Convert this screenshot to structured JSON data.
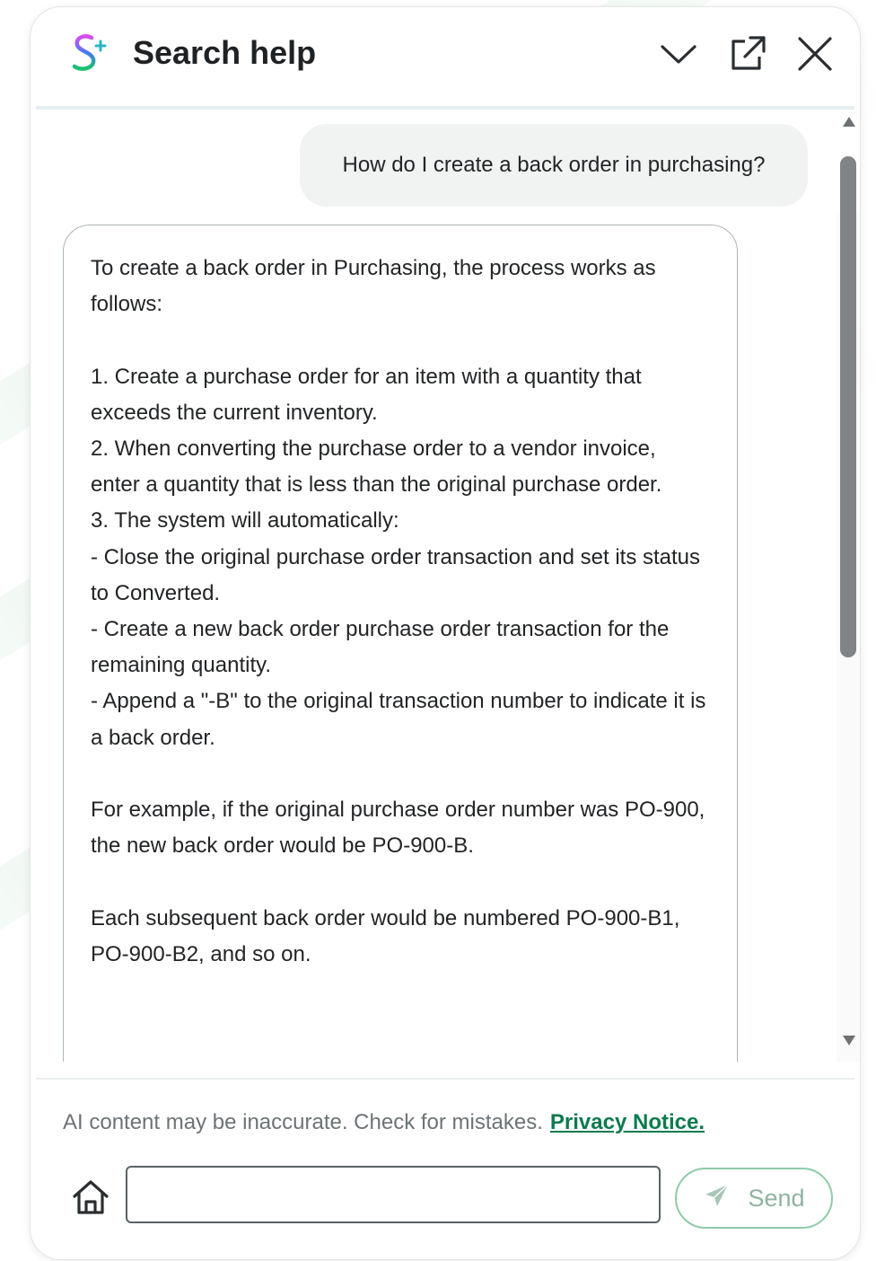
{
  "header": {
    "title": "Search help",
    "icons": {
      "logo": "s-plus-logo-icon",
      "collapse": "chevron-down-icon",
      "popout": "external-link-icon",
      "close": "close-icon"
    }
  },
  "chat": {
    "user_message": "How do I create a back order in purchasing?",
    "ai_response": "To create a back order in Purchasing, the process works as follows:\n\n1. Create a purchase order for an item with a quantity that exceeds the current inventory.\n2. When converting the purchase order to a vendor invoice, enter a quantity that is less than the original purchase order.\n3. The system will automatically:\n- Close the original purchase order transaction and set its status to Converted.\n- Create a new back order purchase order transaction for the remaining quantity.\n- Append a \"-B\" to the original transaction number to indicate it is a back order.\n\nFor example, if the original purchase order number was PO-900, the new back order would be PO-900-B.\n\nEach subsequent back order would be numbered PO-900-B1, PO-900-B2, and so on."
  },
  "footer": {
    "disclaimer": "AI content may be inaccurate. Check for mistakes.",
    "privacy_link": "Privacy Notice.",
    "input_value": "",
    "send_label": "Send",
    "home_icon": "home-icon",
    "send_icon": "send-icon"
  },
  "colors": {
    "accent_green": "#0d7a4f",
    "send_border": "#8fcaa9",
    "bubble_bg": "#f1f3f3"
  }
}
